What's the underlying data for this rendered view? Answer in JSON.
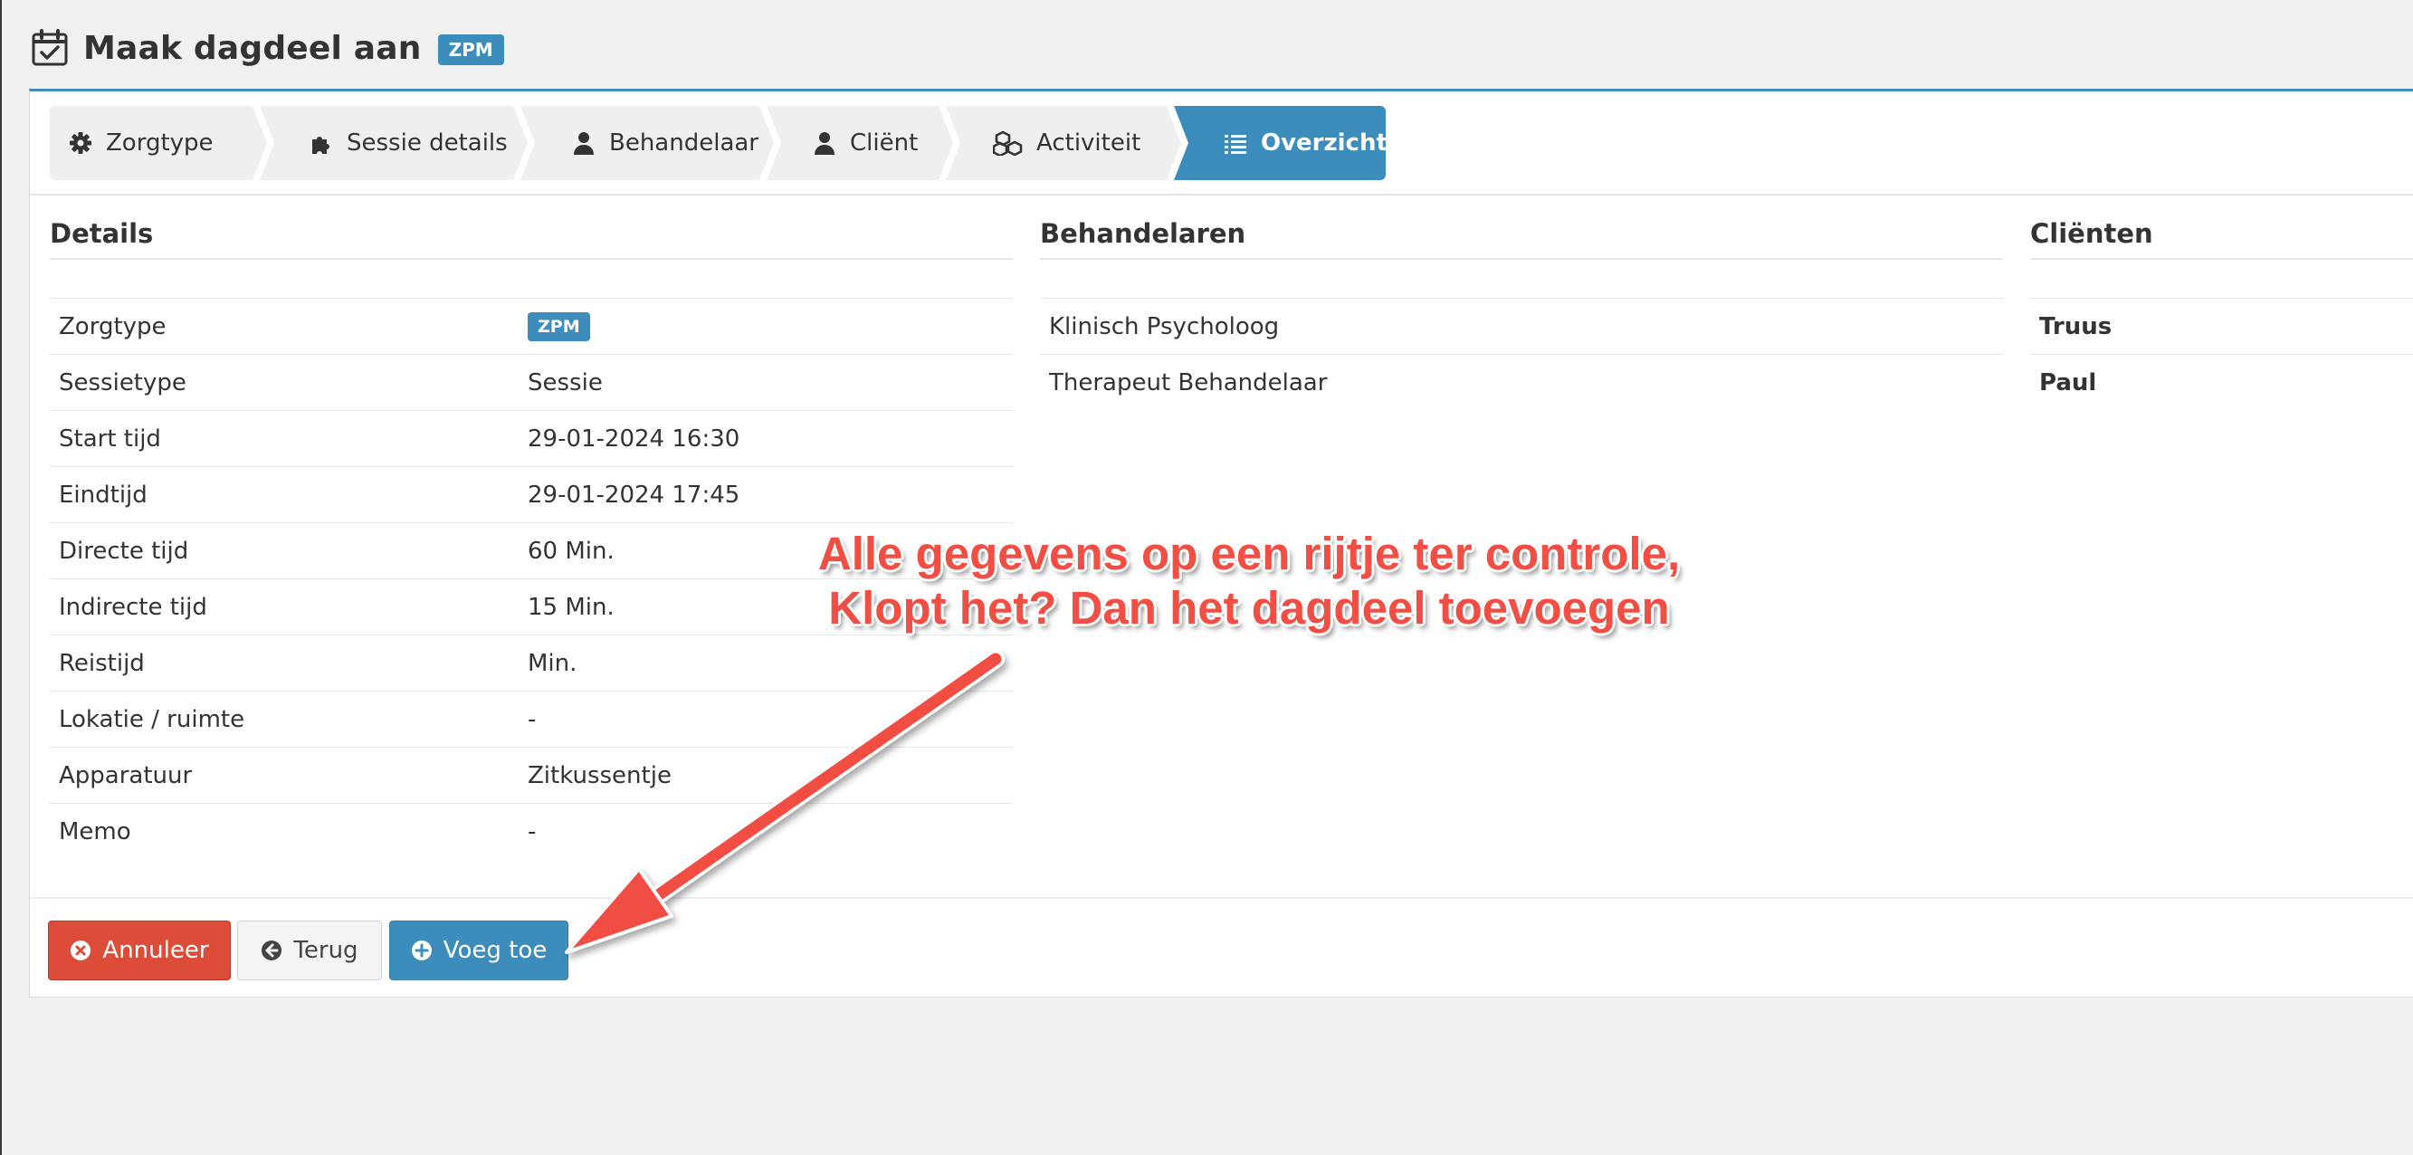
{
  "page": {
    "title": "Maak dagdeel aan",
    "badge": "ZPM"
  },
  "wizard": {
    "steps": [
      {
        "label": "Zorgtype",
        "icon": "gear-icon"
      },
      {
        "label": "Sessie details",
        "icon": "puzzle-icon"
      },
      {
        "label": "Behandelaar",
        "icon": "user-icon"
      },
      {
        "label": "Cliënt",
        "icon": "user-icon"
      },
      {
        "label": "Activiteit",
        "icon": "cubes-icon"
      },
      {
        "label": "Overzicht",
        "icon": "list-icon",
        "active": true
      }
    ]
  },
  "details": {
    "title": "Details",
    "rows": [
      {
        "label": "Zorgtype",
        "value": "ZPM"
      },
      {
        "label": "Sessietype",
        "value": "Sessie"
      },
      {
        "label": "Start tijd",
        "value": "29-01-2024 16:30"
      },
      {
        "label": "Eindtijd",
        "value": "29-01-2024 17:45"
      },
      {
        "label": "Directe tijd",
        "value": "60 Min."
      },
      {
        "label": "Indirecte tijd",
        "value": "15 Min."
      },
      {
        "label": "Reistijd",
        "value": "Min."
      },
      {
        "label": "Lokatie / ruimte",
        "value": "-"
      },
      {
        "label": "Apparatuur",
        "value": "Zitkussentje"
      },
      {
        "label": "Memo",
        "value": "-"
      }
    ]
  },
  "behandelaren": {
    "title": "Behandelaren",
    "items": [
      "Klinisch Psycholoog",
      "Therapeut Behandelaar"
    ]
  },
  "clienten": {
    "title": "Cliënten",
    "items": [
      "Truus",
      "Paul"
    ]
  },
  "buttons": {
    "cancel": "Annuleer",
    "back": "Terug",
    "add": "Voeg toe"
  },
  "annotation": {
    "line1": "Alle gegevens op een rijtje ter controle,",
    "line2": "Klopt het? Dan het dagdeel toevoegen"
  },
  "colors": {
    "primary": "#3c8dbc",
    "danger": "#dd4b39",
    "annotation": "#f24e43"
  }
}
